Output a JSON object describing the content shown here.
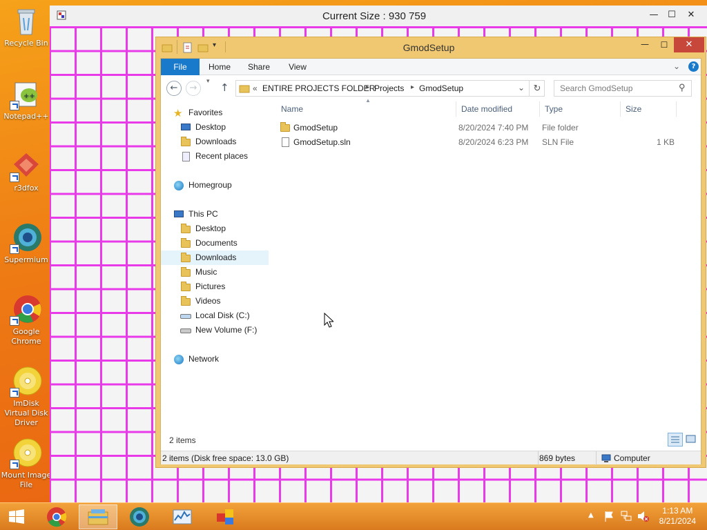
{
  "desktop": {
    "icons": [
      {
        "label": "Recycle Bin",
        "icon": "recycle-bin-icon"
      },
      {
        "label": "Notepad++",
        "icon": "notepad-plus-plus-icon"
      },
      {
        "label": "r3dfox",
        "icon": "r3dfox-icon"
      },
      {
        "label": "Supermium",
        "icon": "supermium-icon"
      },
      {
        "label": "Google Chrome",
        "icon": "chrome-icon"
      },
      {
        "label": "ImDisk Virtual Disk Driver",
        "icon": "disc-icon"
      },
      {
        "label": "Mount Image File",
        "icon": "disc-icon"
      }
    ]
  },
  "grid_window": {
    "title": "Current Size :  930 759",
    "minimize": "—",
    "maximize": "☐",
    "close": "✕",
    "grid_color": "#e83ae8"
  },
  "explorer": {
    "title": "GmodSetup",
    "ribbon_tabs": [
      "File",
      "Home",
      "Share",
      "View"
    ],
    "address": {
      "prefix": "«",
      "crumbs": [
        "ENTIRE PROJECTS FOLDER",
        "Projects",
        "GmodSetup"
      ]
    },
    "search_placeholder": "Search GmodSetup",
    "nav": {
      "favorites": {
        "label": "Favorites",
        "items": [
          "Desktop",
          "Downloads",
          "Recent places"
        ]
      },
      "homegroup": "Homegroup",
      "this_pc": {
        "label": "This PC",
        "items": [
          "Desktop",
          "Documents",
          "Downloads",
          "Music",
          "Pictures",
          "Videos",
          "Local Disk (C:)",
          "New Volume (F:)"
        ]
      },
      "network": "Network",
      "selected": "Downloads"
    },
    "columns": {
      "name": "Name",
      "date": "Date modified",
      "type": "Type",
      "size": "Size"
    },
    "files": [
      {
        "name": "GmodSetup",
        "date": "8/20/2024 7:40 PM",
        "type": "File folder",
        "size": "",
        "kind": "folder"
      },
      {
        "name": "GmodSetup.sln",
        "date": "8/20/2024 6:23 PM",
        "type": "SLN File",
        "size": "1 KB",
        "kind": "file"
      }
    ],
    "item_count": "2 items",
    "status": {
      "left": "2 items (Disk free space: 13.0 GB)",
      "size": "869 bytes",
      "location": "Computer"
    },
    "accent": "#1979ca",
    "frame_color": "#f0c872"
  },
  "taskbar": {
    "clock_time": "1:13 AM",
    "clock_date": "8/21/2024",
    "apps": [
      "chrome-icon",
      "file-explorer-icon",
      "supermium-icon",
      "resource-monitor-icon",
      "control-panel-icon"
    ],
    "active_app": "file-explorer-icon"
  }
}
